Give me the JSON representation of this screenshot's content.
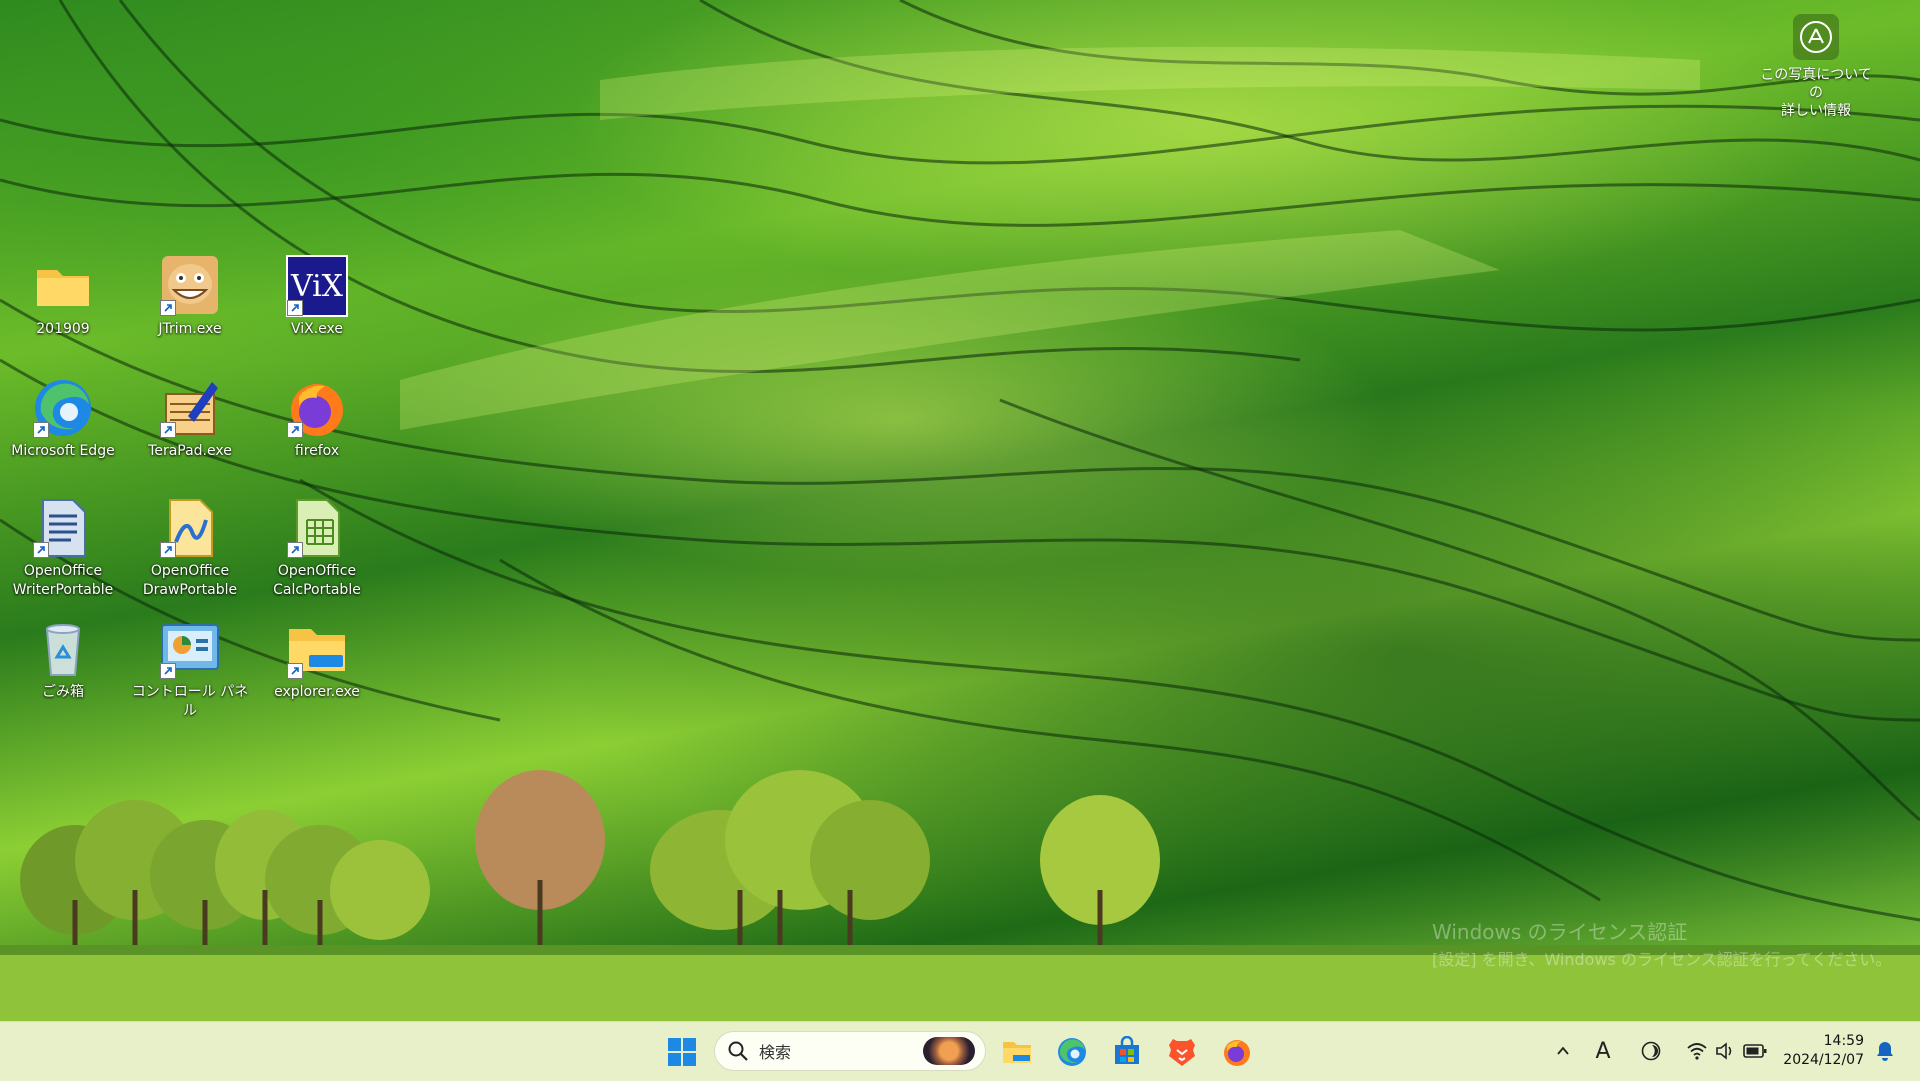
{
  "spotlight": {
    "label": "この写真についての\n詳しい情報"
  },
  "desktop_icons": [
    {
      "label": "201909"
    },
    {
      "label": "JTrim.exe"
    },
    {
      "label": "ViX.exe"
    },
    {
      "label": "Microsoft Edge"
    },
    {
      "label": "TeraPad.exe"
    },
    {
      "label": "firefox"
    },
    {
      "label": "OpenOffice\nWriterPortable"
    },
    {
      "label": "OpenOffice\nDrawPortable"
    },
    {
      "label": "OpenOffice\nCalcPortable"
    },
    {
      "label": "ごみ箱"
    },
    {
      "label": "コントロール パネル"
    },
    {
      "label": "explorer.exe"
    }
  ],
  "watermark": {
    "line1": "Windows のライセンス認証",
    "line2": "[設定] を開き、Windows のライセンス認証を行ってください。"
  },
  "taskbar": {
    "search_placeholder": "検索",
    "ime_label": "A",
    "time": "14:59",
    "date": "2024/12/07"
  },
  "colors": {
    "taskbar_bg": "#e7f0c9",
    "start_blue": "#1e88e5"
  }
}
